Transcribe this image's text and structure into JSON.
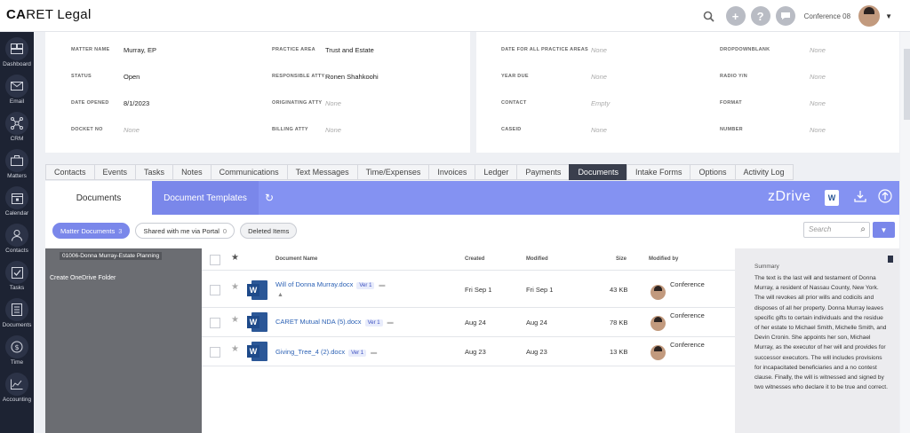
{
  "app": {
    "logo_left": "CA",
    "logo_accent": "RET",
    "logo_right": " Legal"
  },
  "topbar": {
    "user_name": "Conference 08"
  },
  "sidebar": [
    {
      "label": "Dashboard",
      "icon": "dashboard-icon"
    },
    {
      "label": "Email",
      "icon": "email-icon"
    },
    {
      "label": "CRM",
      "icon": "crm-icon"
    },
    {
      "label": "Matters",
      "icon": "matters-icon"
    },
    {
      "label": "Calendar",
      "icon": "calendar-icon"
    },
    {
      "label": "Contacts",
      "icon": "contacts-icon"
    },
    {
      "label": "Tasks",
      "icon": "tasks-icon"
    },
    {
      "label": "Documents",
      "icon": "documents-icon"
    },
    {
      "label": "Time",
      "icon": "time-icon"
    },
    {
      "label": "Accounting",
      "icon": "accounting-icon"
    }
  ],
  "matter_left": {
    "matter_name_label": "MATTER NAME",
    "matter_name": "Murray, EP",
    "status_label": "STATUS",
    "status": "Open",
    "date_opened_label": "DATE OPENED",
    "date_opened": "8/1/2023",
    "docket_no_label": "DOCKET NO",
    "docket_no": "None",
    "practice_area_label": "PRACTICE AREA",
    "practice_area": "Trust and Estate",
    "responsible_atty_label": "RESPONSIBLE ATTY",
    "responsible_atty": "Ronen Shahkoohi",
    "originating_atty_label": "ORIGINATING ATTY",
    "originating_atty": "None",
    "billing_atty_label": "BILLING ATTY",
    "billing_atty": "None"
  },
  "matter_right": {
    "date_all_label": "DATE FOR ALL PRACTICE AREAS",
    "date_all": "None",
    "year_due_label": "YEAR DUE",
    "year_due": "None",
    "contact_label": "CONTACT",
    "contact": "Empty",
    "caseid_label": "CASEID",
    "caseid": "None",
    "dropdownblank_label": "DROPDOWNBLANK",
    "dropdownblank": "None",
    "radio_label": "RADIO Y/N",
    "radio": "None",
    "format_label": "FORMAT",
    "format": "None",
    "number_label": "NUMBER",
    "number": "None"
  },
  "tabs": [
    "Contacts",
    "Events",
    "Tasks",
    "Notes",
    "Communications",
    "Text Messages",
    "Time/Expenses",
    "Invoices",
    "Ledger",
    "Payments",
    "Documents",
    "Intake Forms",
    "Options",
    "Activity Log"
  ],
  "active_tab": "Documents",
  "doc_header": {
    "tab_documents": "Documents",
    "tab_templates": "Document Templates",
    "brand": "zDrive"
  },
  "chips": {
    "matter_docs": "Matter Documents",
    "matter_docs_count": "3",
    "shared": "Shared with me via Portal",
    "shared_count": "0",
    "deleted": "Deleted Items"
  },
  "search": {
    "placeholder": "Search"
  },
  "tree": {
    "folder": "01006-Donna Murray-Estate Planning",
    "create": "Create OneDrive Folder"
  },
  "table": {
    "headers": {
      "name": "Document Name",
      "created": "Created",
      "modified": "Modified",
      "size": "Size",
      "modified_by": "Modified by"
    },
    "rows": [
      {
        "name": "Will of Donna Murray.docx",
        "ver": "Ver 1",
        "created": "Fri Sep 1",
        "modified": "Fri Sep 1",
        "size": "43 KB",
        "by": "Conference"
      },
      {
        "name": "CARET Mutual NDA (5).docx",
        "ver": "Ver 1",
        "created": "Aug 24",
        "modified": "Aug 24",
        "size": "78 KB",
        "by": "Conference"
      },
      {
        "name": "Giving_Tree_4 (2).docx",
        "ver": "Ver 1",
        "created": "Aug 23",
        "modified": "Aug 23",
        "size": "13 KB",
        "by": "Conference"
      }
    ]
  },
  "summary": {
    "title": "Summary",
    "text": "The text is the last will and testament of Donna Murray, a resident of Nassau County, New York. The will revokes all prior wills and codicils and disposes of all her property. Donna Murray leaves specific gifts to certain individuals and the residue of her estate to Michael Smith, Michelle Smith, and Devin Cronin. She appoints her son, Michael Murray, as the executor of her will and provides for successor executors. The will includes provisions for incapacitated beneficiaries and a no contest clause. Finally, the will is witnessed and signed by two witnesses who declare it to be true and correct."
  }
}
